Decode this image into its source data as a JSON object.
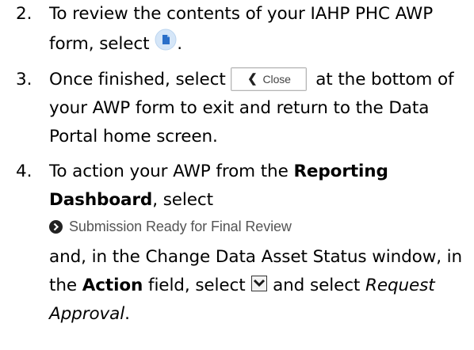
{
  "steps": [
    {
      "number": "2.",
      "text_before": "To review the contents of your IAHP PHC AWP form, select ",
      "text_after": "."
    },
    {
      "number": "3.",
      "text_before": "Once finished, select ",
      "button_label": "Close",
      "text_after": " at the bottom of your AWP form to exit and return to the Data Portal home screen."
    },
    {
      "number": "4.",
      "text_1": "To action your AWP from the ",
      "bold_1": "Reporting Dashboard",
      "text_2": ", select",
      "status_link": "Submission Ready for Final Review",
      "text_3": "and, in the Change Data Asset Status window, in the ",
      "bold_2": "Action",
      "text_4": " field, select ",
      "text_5": " and select ",
      "italic_1": "Request Approval",
      "text_6": "."
    }
  ],
  "icons": {
    "document": "document-icon",
    "chevron": "chevron-left-icon",
    "status_arrow": "circle-arrow-right-icon",
    "dropdown": "dropdown-chevron-icon"
  },
  "colors": {
    "doc_icon_bg": "#cfe3f7",
    "doc_icon_fg": "#2a6fc9",
    "status_text": "#555555"
  }
}
